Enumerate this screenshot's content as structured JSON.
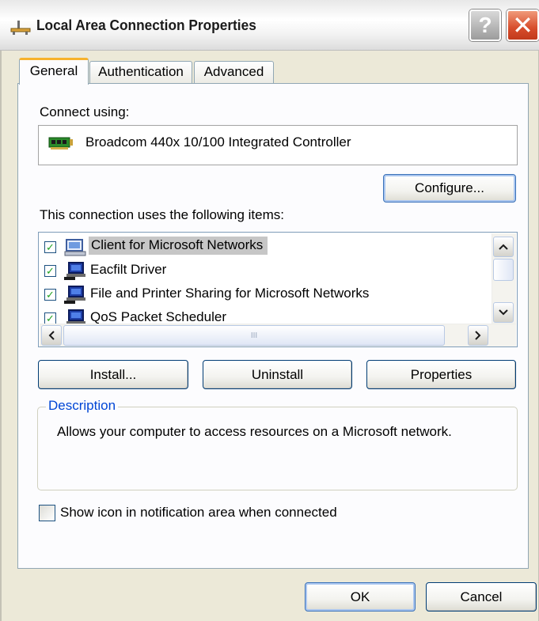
{
  "window": {
    "title": "Local Area Connection Properties",
    "help_glyph": "?",
    "close_glyph": "✕"
  },
  "tabs": [
    {
      "label": "General",
      "selected": true
    },
    {
      "label": "Authentication",
      "selected": false
    },
    {
      "label": "Advanced",
      "selected": false
    }
  ],
  "general": {
    "connect_using_label": "Connect using:",
    "adapter_name": "Broadcom 440x 10/100 Integrated Controller",
    "configure_label": "Configure...",
    "items_label": "This connection uses the following items:",
    "items": [
      {
        "label": "Client for Microsoft Networks",
        "checked": true,
        "selected": true,
        "icon": "network-client-icon"
      },
      {
        "label": "Eacfilt Driver",
        "checked": true,
        "selected": false,
        "icon": "network-driver-icon"
      },
      {
        "label": "File and Printer Sharing for Microsoft Networks",
        "checked": true,
        "selected": false,
        "icon": "network-service-icon"
      },
      {
        "label": "QoS Packet Scheduler",
        "checked": true,
        "selected": false,
        "icon": "network-service-icon"
      }
    ],
    "hscroll_grip": "III",
    "install_label": "Install...",
    "uninstall_label": "Uninstall",
    "properties_label": "Properties",
    "description_title": "Description",
    "description_text": "Allows your computer to access resources on a Microsoft network.",
    "notify_label": "Show icon in notification area when connected",
    "notify_checked": false
  },
  "footer": {
    "ok_label": "OK",
    "cancel_label": "Cancel"
  },
  "colors": {
    "dialog_bg": "#ece9d8",
    "tab_accent": "#f7b22c",
    "button_border": "#003c74",
    "close_red": "#d74d2c",
    "description_title": "#0046d5",
    "selection_bg": "#c6c6c6"
  }
}
